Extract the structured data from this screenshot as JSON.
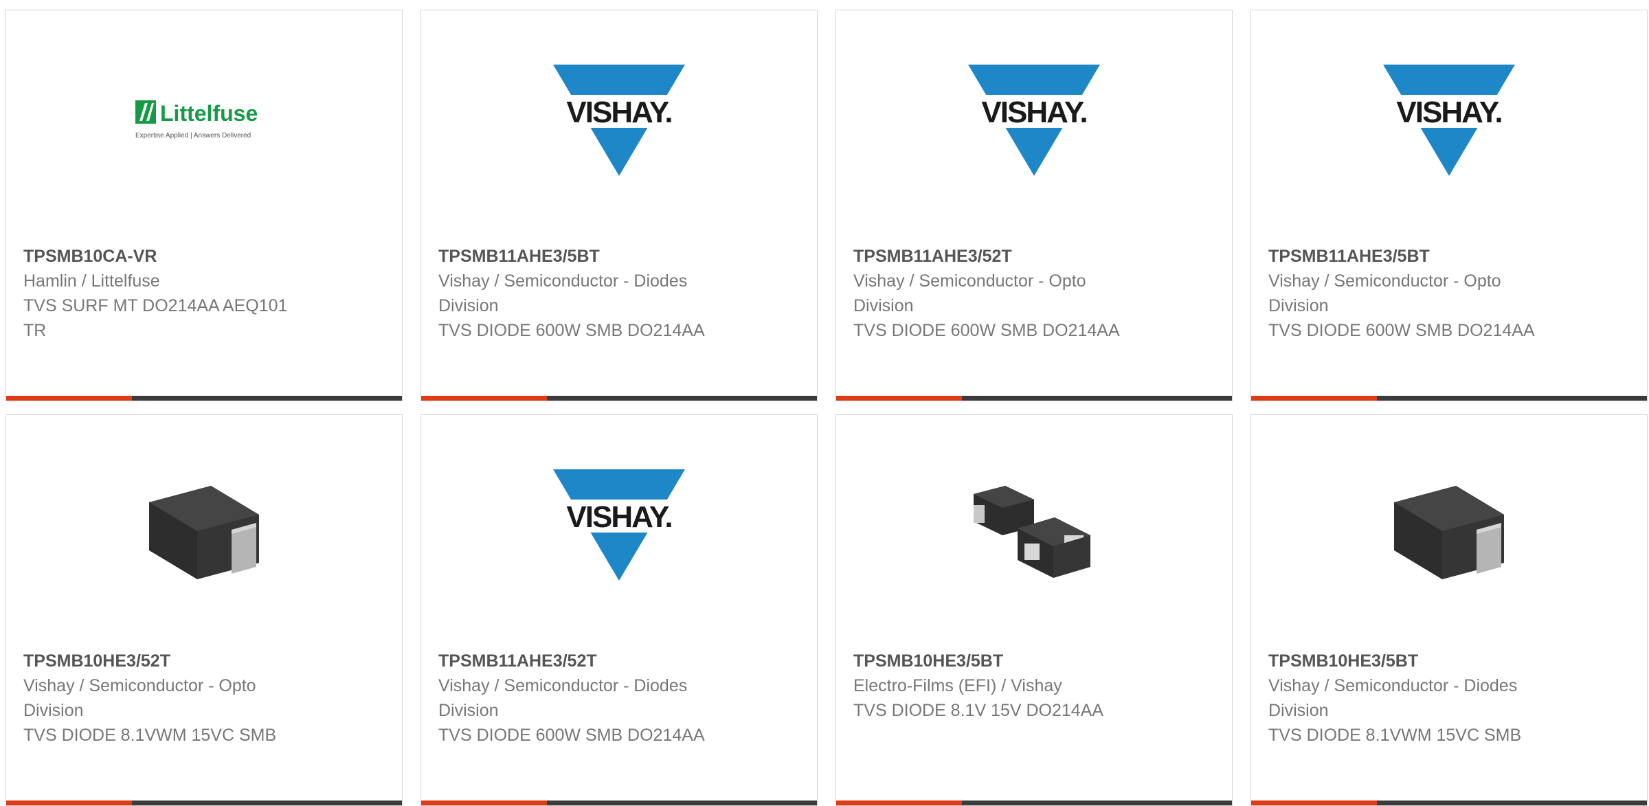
{
  "colors": {
    "accent": "#e03b15",
    "bar": "#3b3b3b",
    "vishay_blue": "#1e87c8",
    "littelfuse_green": "#159b45"
  },
  "products": [
    {
      "part_number": "TPSMB10CA-VR",
      "manufacturer": "Hamlin / Littelfuse",
      "description": "TVS SURF MT DO214AA AEQ101 TR",
      "image": "littelfuse-logo",
      "logo": {
        "name": "Littelfuse",
        "tagline": "Expertise Applied | Answers Delivered"
      }
    },
    {
      "part_number": "TPSMB11AHE3/5BT",
      "manufacturer": "Vishay / Semiconductor - Diodes Division",
      "description": "TVS DIODE 600W SMB DO214AA",
      "image": "vishay-logo",
      "logo": {
        "name": "VISHAY."
      }
    },
    {
      "part_number": "TPSMB11AHE3/52T",
      "manufacturer": "Vishay / Semiconductor - Opto Division",
      "description": "TVS DIODE 600W SMB DO214AA",
      "image": "vishay-logo",
      "logo": {
        "name": "VISHAY."
      }
    },
    {
      "part_number": "TPSMB11AHE3/5BT",
      "manufacturer": "Vishay / Semiconductor - Opto Division",
      "description": "TVS DIODE 600W SMB DO214AA",
      "image": "vishay-logo",
      "logo": {
        "name": "VISHAY."
      }
    },
    {
      "part_number": "TPSMB10HE3/52T",
      "manufacturer": "Vishay / Semiconductor - Opto Division",
      "description": "TVS DIODE 8.1VWM 15VC SMB",
      "image": "smb-package-photo"
    },
    {
      "part_number": "TPSMB11AHE3/52T",
      "manufacturer": "Vishay / Semiconductor - Diodes Division",
      "description": "TVS DIODE 600W SMB DO214AA",
      "image": "vishay-logo",
      "logo": {
        "name": "VISHAY."
      }
    },
    {
      "part_number": "TPSMB10HE3/5BT",
      "manufacturer": "Electro-Films (EFI) / Vishay",
      "description": "TVS DIODE 8.1V 15V DO214AA",
      "image": "smb-pair-photo"
    },
    {
      "part_number": "TPSMB10HE3/5BT",
      "manufacturer": "Vishay / Semiconductor - Diodes Division",
      "description": "TVS DIODE 8.1VWM 15VC SMB",
      "image": "smb-package-photo"
    }
  ]
}
